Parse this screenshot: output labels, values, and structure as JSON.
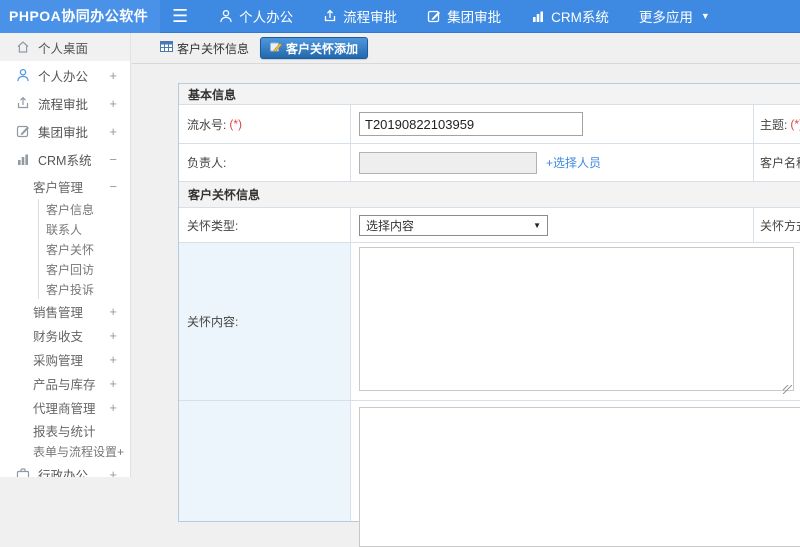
{
  "colors": {
    "topbar": "#3e8ae3",
    "logo_bg": "#4a92e8",
    "active_tab_top": "#4f97dd",
    "active_tab_bottom": "#2268ad",
    "required": "#e04343",
    "link": "#3e8ae3",
    "highlight_cell": "#edf5fc"
  },
  "topbar": {
    "logo": "PHPOA协同办公软件",
    "nav": [
      {
        "label": "个人办公"
      },
      {
        "label": "流程审批"
      },
      {
        "label": "集团审批"
      },
      {
        "label": "CRM系统"
      },
      {
        "label": "更多应用"
      }
    ]
  },
  "sidebar": {
    "items": [
      {
        "label": "个人桌面",
        "expand": ""
      },
      {
        "label": "个人办公",
        "expand": "+"
      },
      {
        "label": "流程审批",
        "expand": "+"
      },
      {
        "label": "集团审批",
        "expand": "+"
      },
      {
        "label": "CRM系统",
        "expand": "−"
      },
      {
        "label": "客户管理",
        "expand": "−"
      },
      {
        "label": "客户信息",
        "expand": ""
      },
      {
        "label": "联系人",
        "expand": ""
      },
      {
        "label": "客户关怀",
        "expand": ""
      },
      {
        "label": "客户回访",
        "expand": ""
      },
      {
        "label": "客户投诉",
        "expand": ""
      },
      {
        "label": "销售管理",
        "expand": "+"
      },
      {
        "label": "财务收支",
        "expand": "+"
      },
      {
        "label": "采购管理",
        "expand": "+"
      },
      {
        "label": "产品与库存",
        "expand": "+"
      },
      {
        "label": "代理商管理",
        "expand": "+"
      },
      {
        "label": "报表与统计",
        "expand": ""
      },
      {
        "label": "表单与流程设置+",
        "expand": ""
      },
      {
        "label": "行政办公",
        "expand": "+"
      }
    ]
  },
  "tabs": {
    "list_tab": "客户关怀信息",
    "add_tab": "客户关怀添加"
  },
  "form": {
    "section_basic": "基本信息",
    "serial_label": "流水号:",
    "serial_required": "(*)",
    "serial_value": "T20190822103959",
    "subject_label": "主题:",
    "subject_required": "(*)",
    "owner_label": "负责人:",
    "owner_value": "",
    "owner_link": "+选择人员",
    "customer_label": "客户名称:",
    "customer_required": "(*)",
    "section_care": "客户关怀信息",
    "care_type_label": "关怀类型:",
    "care_type_value": "选择内容",
    "care_method_label": "关怀方式:",
    "care_content_label": "关怀内容:"
  }
}
